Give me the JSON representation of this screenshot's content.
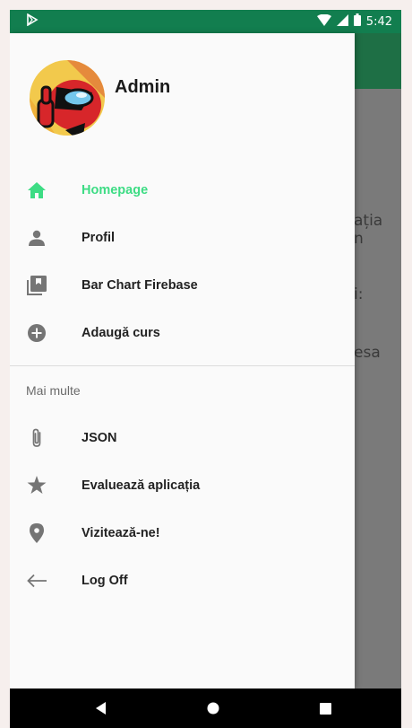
{
  "status_bar": {
    "time": "5:42"
  },
  "background": {
    "lines": [
      "ația",
      "n",
      "i:",
      "esa"
    ]
  },
  "drawer": {
    "user_name": "Admin",
    "items": [
      {
        "label": "Homepage",
        "icon": "home-icon",
        "active": true
      },
      {
        "label": "Profil",
        "icon": "person-icon"
      },
      {
        "label": "Bar Chart Firebase",
        "icon": "library-icon"
      },
      {
        "label": "Adaugă curs",
        "icon": "add-circle-icon"
      }
    ],
    "section_title": "Mai multe",
    "more_items": [
      {
        "label": "JSON",
        "icon": "paperclip-icon"
      },
      {
        "label": "Evaluează aplicația",
        "icon": "star-icon"
      },
      {
        "label": "Vizitează-ne!",
        "icon": "location-pin-icon"
      },
      {
        "label": "Log Off",
        "icon": "arrow-left-icon"
      }
    ]
  },
  "colors": {
    "accent": "#3ddc84",
    "status_bar": "#127e4f",
    "toolbar": "#1e6f45"
  }
}
